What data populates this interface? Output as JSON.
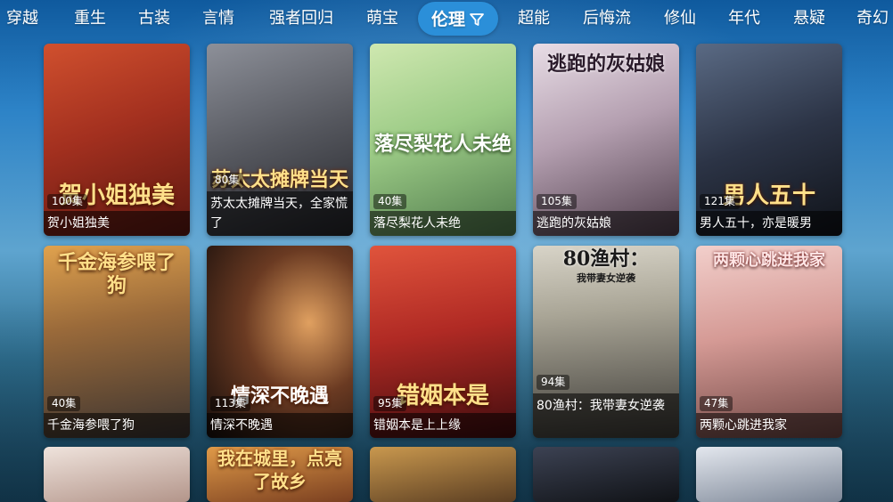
{
  "nav": {
    "tabs": [
      {
        "label": "穿越"
      },
      {
        "label": "重生"
      },
      {
        "label": "古装"
      },
      {
        "label": "言情"
      },
      {
        "label": "强者回归"
      },
      {
        "label": "萌宝"
      },
      {
        "label": "伦理",
        "active": true
      },
      {
        "label": "超能"
      },
      {
        "label": "后悔流"
      },
      {
        "label": "修仙"
      },
      {
        "label": "年代"
      },
      {
        "label": "悬疑"
      },
      {
        "label": "奇幻"
      }
    ]
  },
  "dramas": [
    {
      "title": "贺小姐独美",
      "episodes": "100集",
      "poster_text": "贺小姐独美",
      "colors": [
        "#c2452a",
        "#6b1c12"
      ]
    },
    {
      "title": "苏太太摊牌当天，全家慌了",
      "episodes": "80集",
      "poster_text": "苏太太摊牌当天",
      "colors": [
        "#6d6f75",
        "#2a2b30"
      ]
    },
    {
      "title": "落尽梨花人未绝",
      "episodes": "40集",
      "poster_text": "落尽梨花人未绝",
      "colors": [
        "#a9d08c",
        "#5f8a58"
      ]
    },
    {
      "title": "逃跑的灰姑娘",
      "episodes": "105集",
      "poster_text": "逃跑的灰姑娘",
      "colors": [
        "#d7c7d2",
        "#6f5a6a"
      ]
    },
    {
      "title": "男人五十，亦是暖男",
      "episodes": "121集",
      "poster_text": "男人五十",
      "colors": [
        "#3d4a60",
        "#151a24"
      ]
    },
    {
      "title": "千金海参喂了狗",
      "episodes": "40集",
      "poster_text": "千金海参喂了狗",
      "colors": [
        "#c98a3c",
        "#3a2f2a"
      ]
    },
    {
      "title": "情深不晚遇",
      "episodes": "113集",
      "poster_text": "情深不晚遇",
      "colors": [
        "#7a4a2a",
        "#1a1110"
      ]
    },
    {
      "title": "错姻本是上上缘",
      "episodes": "95集",
      "poster_text": "错姻本是",
      "colors": [
        "#c23a2a",
        "#4a0f10"
      ]
    },
    {
      "title": "80渔村：我带妻女逆袭",
      "episodes": "94集",
      "poster_text": "80渔村：",
      "subtitle": "我带妻女逆袭",
      "colors": [
        "#b7b4a8",
        "#59574f"
      ]
    },
    {
      "title": "两颗心跳进我家",
      "episodes": "47集",
      "poster_text": "两颗心跳进我家",
      "colors": [
        "#e8b9b6",
        "#8a5c58"
      ]
    }
  ],
  "row3": [
    {
      "poster_text": "",
      "colors": [
        "#e9d9d2",
        "#9d7e74"
      ]
    },
    {
      "poster_text": "我在城里，点亮了故乡",
      "colors": [
        "#d9893e",
        "#6e3a1e"
      ]
    },
    {
      "poster_text": "",
      "colors": [
        "#b98a4c",
        "#5b3e22"
      ]
    },
    {
      "poster_text": "",
      "colors": [
        "#2f3442",
        "#111318"
      ]
    },
    {
      "poster_text": "",
      "colors": [
        "#d6dbe3",
        "#7d8797"
      ]
    }
  ]
}
